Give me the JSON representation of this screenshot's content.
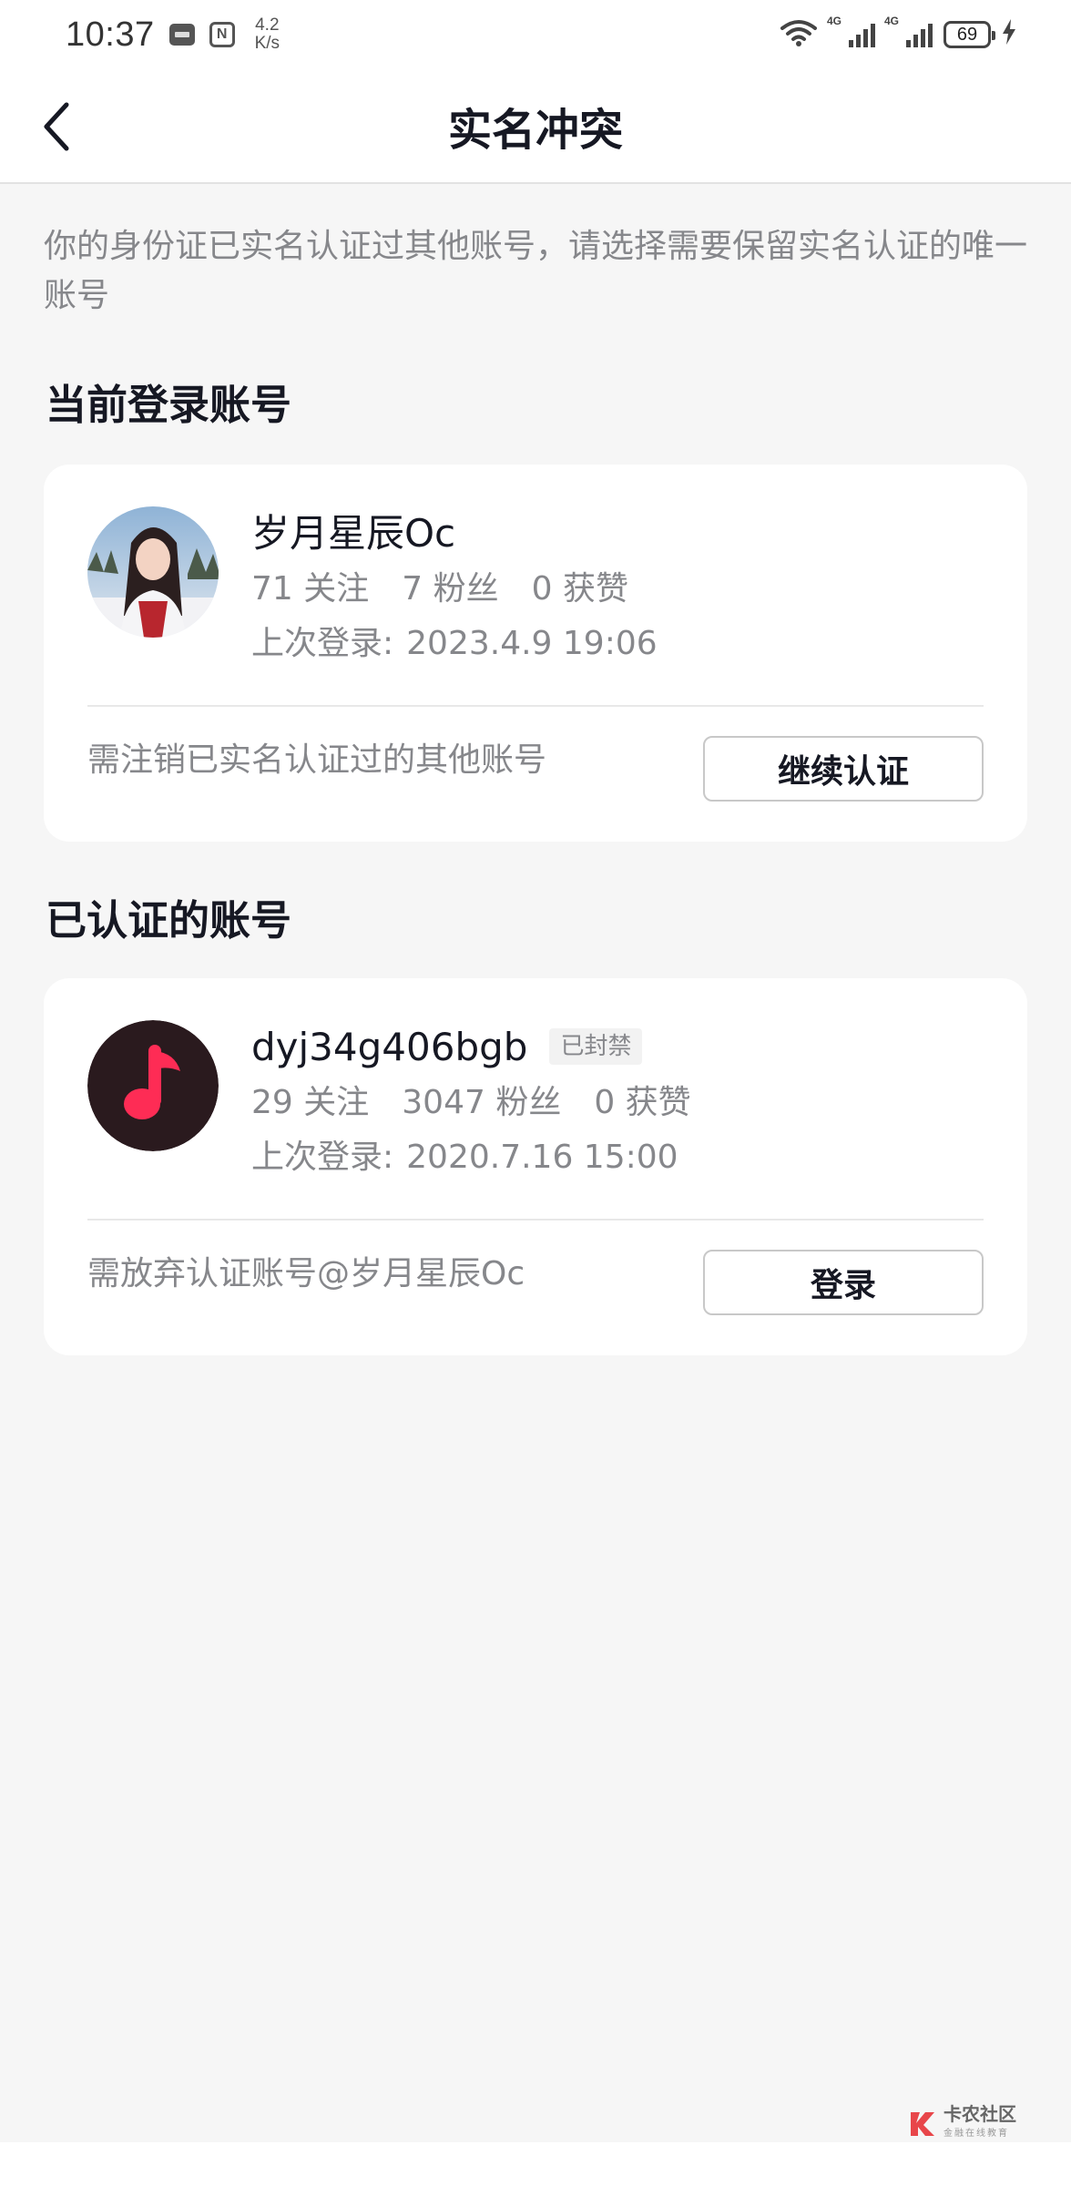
{
  "status_bar": {
    "time": "10:37",
    "speed_value": "4.2",
    "speed_unit": "K/s",
    "net1_label": "4G",
    "net2_label": "4G",
    "battery": "69"
  },
  "nav": {
    "title": "实名冲突"
  },
  "intro_text": "你的身份证已实名认证过其他账号，请选择需要保留实名认证的唯一账号",
  "current_section": {
    "title": "当前登录账号",
    "account": {
      "name": "岁月星辰Oc",
      "following": "71 关注",
      "followers": "7 粉丝",
      "likes": "0 获赞",
      "last_login_label": "上次登录:",
      "last_login_value": "2023.4.9 19:06"
    },
    "note": "需注销已实名认证过的其他账号",
    "button_label": "继续认证"
  },
  "verified_section": {
    "title": "已认证的账号",
    "account": {
      "name": "dyj34g406bgb",
      "status_tag": "已封禁",
      "following": "29 关注",
      "followers": "3047 粉丝",
      "likes": "0 获赞",
      "last_login_label": "上次登录:",
      "last_login_value": "2020.7.16 15:00"
    },
    "note": "需放弃认证账号@岁月星辰Oc",
    "button_label": "登录"
  },
  "watermark": {
    "main": "卡农社区",
    "sub": "金融在线教育"
  },
  "colors": {
    "background": "#f6f6f6",
    "card": "#ffffff",
    "primary_text": "#161823",
    "secondary_text": "#86878b",
    "music_avatar_bg": "#2a1a1e",
    "music_note": "#fe2c55"
  },
  "icons": {
    "back": "chevron-left-icon",
    "wifi": "wifi-icon",
    "signal": "signal-icon",
    "battery": "battery-icon",
    "charging": "bolt-icon",
    "music": "music-note-icon"
  }
}
